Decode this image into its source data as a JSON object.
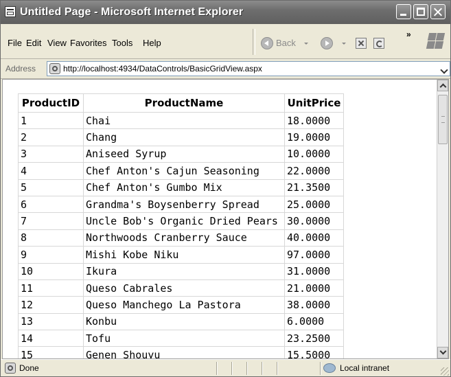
{
  "window": {
    "title": "Untitled Page - Microsoft Internet Explorer"
  },
  "menu": [
    "File",
    "Edit",
    "View",
    "Favorites",
    "Tools",
    "Help"
  ],
  "toolbar": {
    "back_label": "Back",
    "more": "»"
  },
  "address": {
    "label": "Address",
    "url": "http://localhost:4934/DataControls/BasicGridView.aspx"
  },
  "grid": {
    "headers": [
      "ProductID",
      "ProductName",
      "UnitPrice"
    ],
    "rows": [
      [
        "1",
        "Chai",
        "18.0000"
      ],
      [
        "2",
        "Chang",
        "19.0000"
      ],
      [
        "3",
        "Aniseed Syrup",
        "10.0000"
      ],
      [
        "4",
        "Chef Anton's Cajun Seasoning",
        "22.0000"
      ],
      [
        "5",
        "Chef Anton's Gumbo Mix",
        "21.3500"
      ],
      [
        "6",
        "Grandma's Boysenberry Spread",
        "25.0000"
      ],
      [
        "7",
        "Uncle Bob's Organic Dried Pears",
        "30.0000"
      ],
      [
        "8",
        "Northwoods Cranberry Sauce",
        "40.0000"
      ],
      [
        "9",
        "Mishi Kobe Niku",
        "97.0000"
      ],
      [
        "10",
        "Ikura",
        "31.0000"
      ],
      [
        "11",
        "Queso Cabrales",
        "21.0000"
      ],
      [
        "12",
        "Queso Manchego La Pastora",
        "38.0000"
      ],
      [
        "13",
        "Konbu",
        "6.0000"
      ],
      [
        "14",
        "Tofu",
        "23.2500"
      ],
      [
        "15",
        "Genen Shouyu",
        "15.5000"
      ]
    ]
  },
  "status": {
    "text": "Done",
    "zone": "Local intranet"
  },
  "icons": {
    "app": "ie-page-icon",
    "back": "back-arrow-icon",
    "forward": "forward-arrow-icon",
    "stop": "stop-icon",
    "refresh": "refresh-icon",
    "page": "page-icon",
    "zone": "intranet-zone-icon"
  }
}
